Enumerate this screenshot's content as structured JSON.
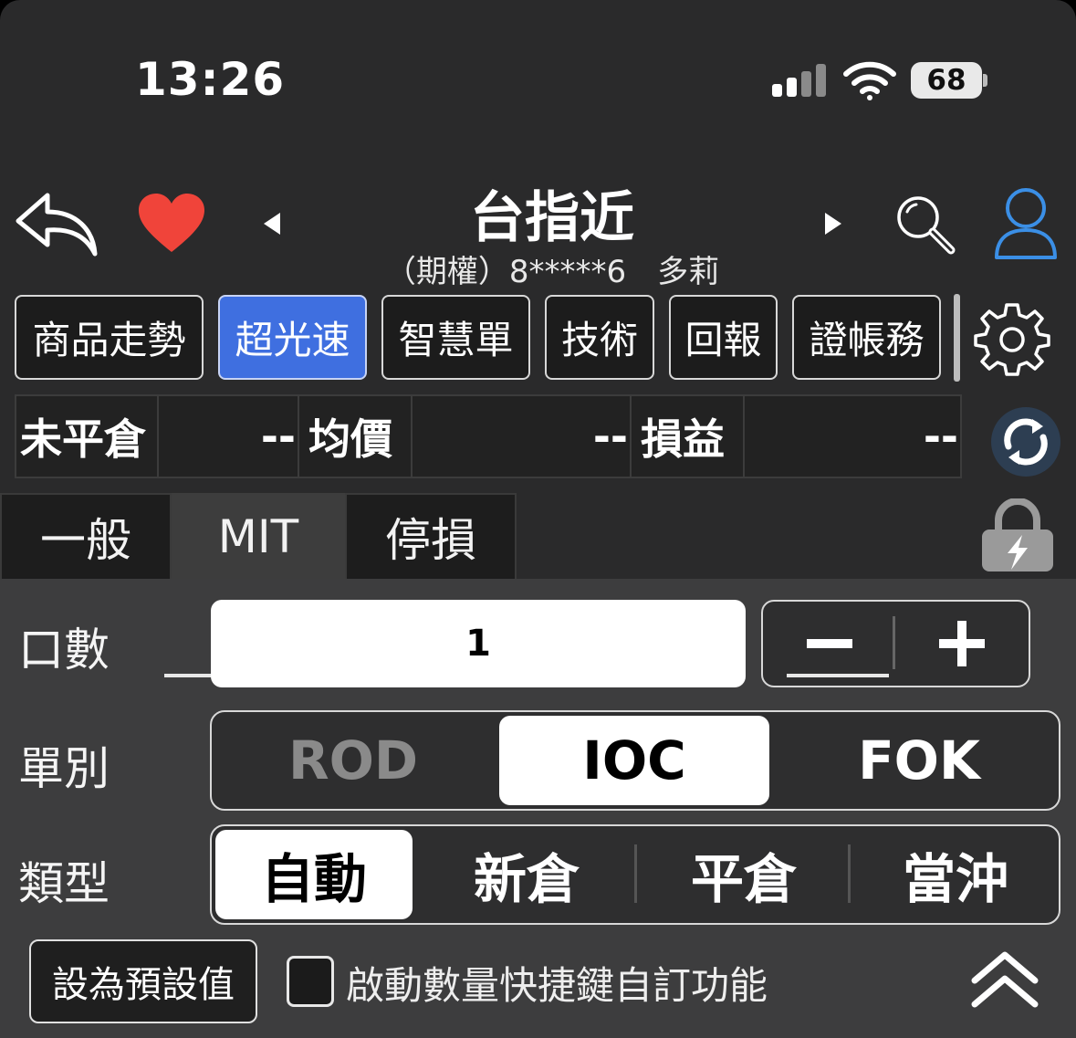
{
  "status_bar": {
    "time": "13:26",
    "battery": "68"
  },
  "header": {
    "title": "台指近",
    "subtitle": "（期權）8*****6　多莉"
  },
  "nav_tabs": [
    {
      "label": "商品走勢"
    },
    {
      "label": "超光速",
      "active": true
    },
    {
      "label": "智慧單"
    },
    {
      "label": "技術"
    },
    {
      "label": "回報"
    },
    {
      "label": "證帳務"
    }
  ],
  "position": {
    "open_label": "未平倉",
    "open_value": "--",
    "avg_label": "均價",
    "avg_value": "--",
    "pnl_label": "損益",
    "pnl_value": "--"
  },
  "order_tabs": [
    {
      "label": "一般"
    },
    {
      "label": "MIT",
      "active": true
    },
    {
      "label": "停損"
    }
  ],
  "form": {
    "quantity_label": "口數",
    "quantity_value": "1",
    "order_kind_label": "單別",
    "order_kinds": [
      "ROD",
      "IOC",
      "FOK"
    ],
    "order_kind_selected": "IOC",
    "type_label": "類型",
    "types": [
      "自動",
      "新倉",
      "平倉",
      "當沖"
    ],
    "type_selected": "自動",
    "set_default_label": "設為預設值",
    "shortcut_label": "啟動數量快捷鍵自訂功能"
  },
  "colors": {
    "accent": "#3f6fe0",
    "heart": "#f0443a",
    "user_icon": "#3b8fe6",
    "background": "#2a2a2b",
    "panel": "#3d3d3e"
  }
}
